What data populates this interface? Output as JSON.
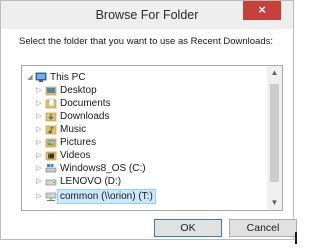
{
  "window": {
    "title": "Browse For Folder",
    "close_glyph": "×",
    "close_color": "#c7403a"
  },
  "instruction": "Select the folder that you want to use as Recent Downloads:",
  "tree": {
    "items": [
      {
        "label": "This PC",
        "icon": "computer-icon",
        "expanded": true
      },
      {
        "label": "Desktop",
        "icon": "folder-icon"
      },
      {
        "label": "Documents",
        "icon": "documents-folder-icon"
      },
      {
        "label": "Downloads",
        "icon": "downloads-folder-icon"
      },
      {
        "label": "Music",
        "icon": "music-folder-icon"
      },
      {
        "label": "Pictures",
        "icon": "pictures-folder-icon"
      },
      {
        "label": "Videos",
        "icon": "videos-folder-icon"
      },
      {
        "label": "Windows8_OS (C:)",
        "icon": "windows-drive-icon"
      },
      {
        "label": "LENOVO (D:)",
        "icon": "drive-icon"
      },
      {
        "label": "common (\\\\orion) (T:)",
        "icon": "network-drive-icon",
        "selected": true
      }
    ],
    "selection_color": "#cce8ff"
  },
  "buttons": {
    "ok": "OK",
    "cancel": "Cancel"
  }
}
